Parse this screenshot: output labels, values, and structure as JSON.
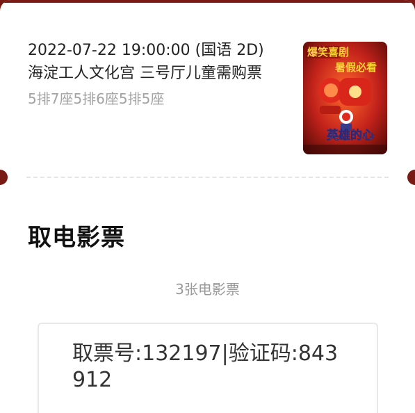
{
  "order": {
    "showtime": "2022-07-22 19:00:00 (国语 2D)",
    "cinema_hall": "海淀工人文化宫 三号厅儿童需购票",
    "seats": "5排7座5排6座5排5座"
  },
  "poster": {
    "tagline_top": "爆笑喜剧",
    "tagline_bottom": "暑假必看",
    "title_art": "英雄的心"
  },
  "pickup": {
    "section_title": "取电影票",
    "ticket_count": "3张电影票",
    "code_text": "取票号:132197|验证码:843912"
  },
  "colors": {
    "brand_dark_red": "#7a1a14",
    "poster_red": "#c4231b"
  }
}
